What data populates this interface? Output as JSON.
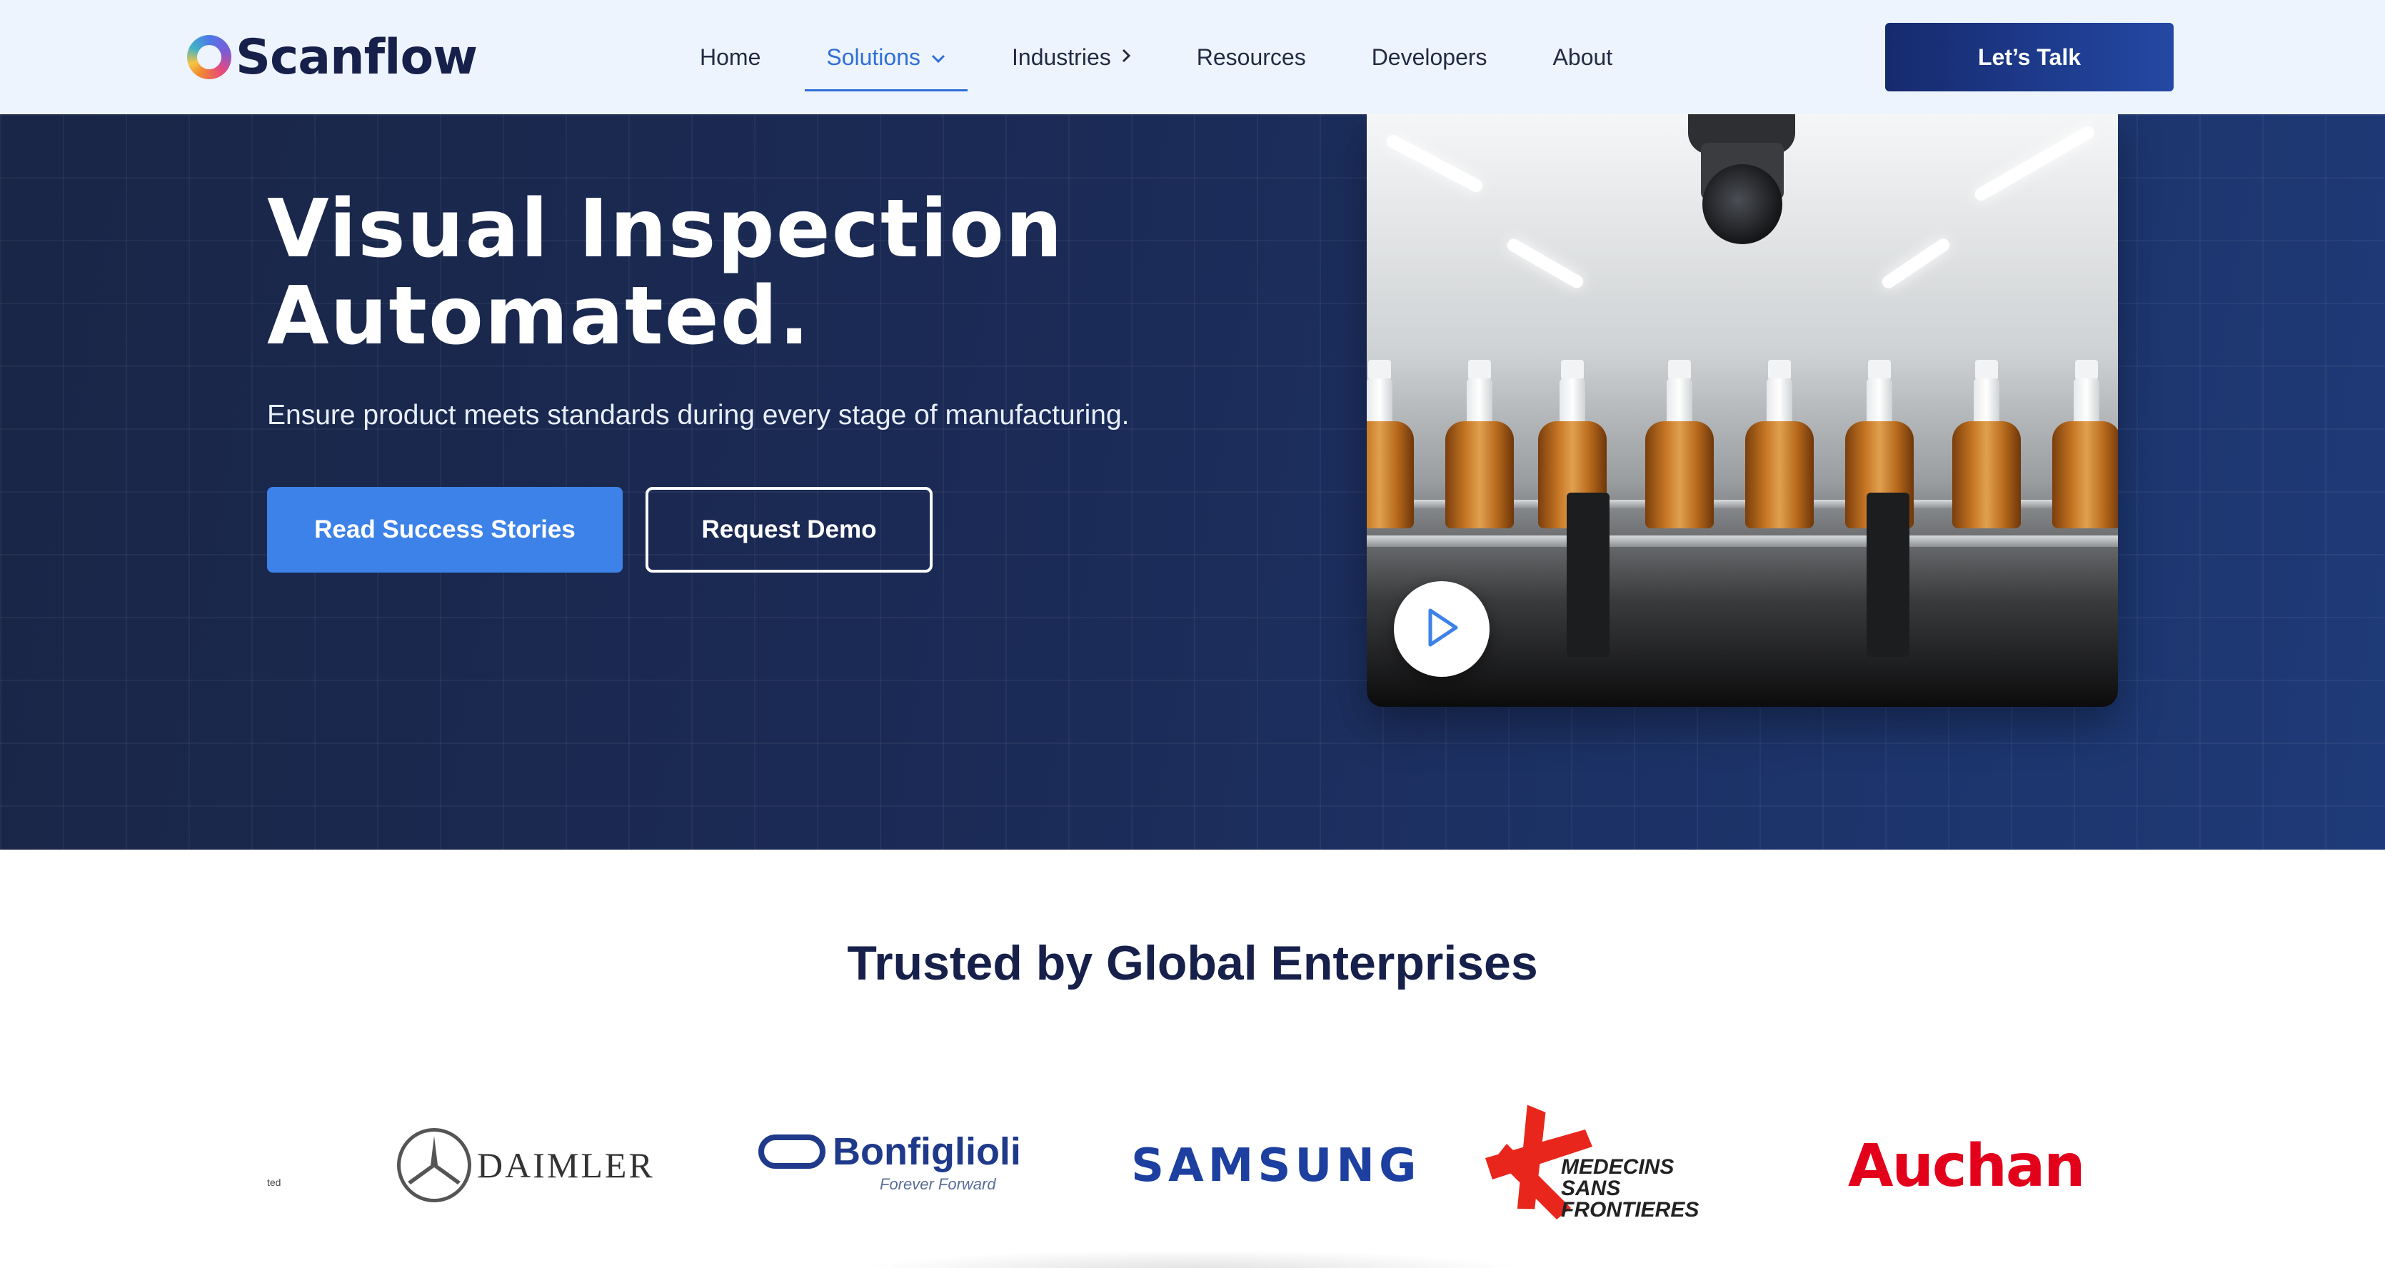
{
  "brand": {
    "name": "Scanflow",
    "ring_colors": [
      "#4f79e8",
      "#e84a7a",
      "#f08a2f",
      "#f5c542",
      "#3fb3c7"
    ]
  },
  "nav": {
    "items": [
      {
        "label": "Home",
        "active": false
      },
      {
        "label": "Solutions",
        "active": true,
        "indicator": "chevron-down"
      },
      {
        "label": "Industries",
        "active": false,
        "indicator": "chevron-right"
      },
      {
        "label": "Resources",
        "active": false
      },
      {
        "label": "Developers",
        "active": false
      },
      {
        "label": "About",
        "active": false
      }
    ],
    "cta_label": "Let’s Talk"
  },
  "hero": {
    "title_line1": "Visual Inspection",
    "title_line2": "Automated.",
    "subtitle": "Ensure product meets standards during every stage of manufacturing.",
    "primary_button": "Read Success Stories",
    "secondary_button": "Request Demo",
    "video_play_icon": "play-icon"
  },
  "trusted": {
    "title": "Trusted by Global Enterprises",
    "logos": {
      "clipped": "ted",
      "daimler": "DAIMLER",
      "bonfiglioli": "Bonfiglioli",
      "bonfiglioli_tagline": "Forever Forward",
      "samsung": "SAMSUNG",
      "msf_line1": "MEDECINS",
      "msf_line2": "SANS FRONTIERES",
      "auchan": "Auchan"
    }
  },
  "colors": {
    "nav_bg": "#edf4fd",
    "accent_blue": "#2f6fd8",
    "hero_bg": "#1b2b57",
    "primary_button": "#3d82e8",
    "cta": "#1e3a8a",
    "heading_navy": "#16204a"
  }
}
